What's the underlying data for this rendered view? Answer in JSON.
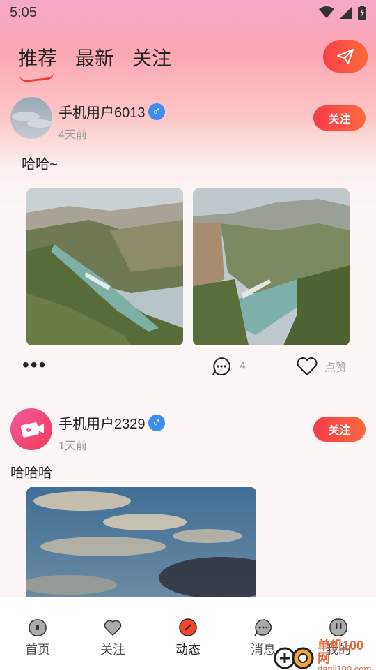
{
  "status": {
    "time": "5:05"
  },
  "header": {
    "tabs": [
      {
        "label": "推荐",
        "active": true
      },
      {
        "label": "最新",
        "active": false
      },
      {
        "label": "关注",
        "active": false
      }
    ],
    "send_icon": "paper-plane-icon"
  },
  "posts": [
    {
      "username": "手机用户6013",
      "gender": "♂",
      "time": "4天前",
      "follow_label": "关注",
      "text": "哈哈~",
      "image_count": 2,
      "more_label": "•••",
      "comment_count": "4",
      "like_label": "点赞"
    },
    {
      "username": "手机用户2329",
      "gender": "♂",
      "time": "1天前",
      "follow_label": "关注",
      "text": "哈哈哈",
      "image_count": 1
    }
  ],
  "nav": [
    {
      "label": "首页",
      "icon": "home-icon",
      "active": false
    },
    {
      "label": "关注",
      "icon": "heart-icon",
      "active": false
    },
    {
      "label": "动态",
      "icon": "dynamic-icon",
      "active": true
    },
    {
      "label": "消息",
      "icon": "message-icon",
      "active": false
    },
    {
      "label": "我的",
      "icon": "profile-icon",
      "active": false
    }
  ],
  "watermark": {
    "title": "单机100网",
    "url": "danji100.com"
  },
  "colors": {
    "accent": "#f9394a",
    "accent2": "#fb6b3e",
    "gender_blue": "#3d8ef0"
  }
}
